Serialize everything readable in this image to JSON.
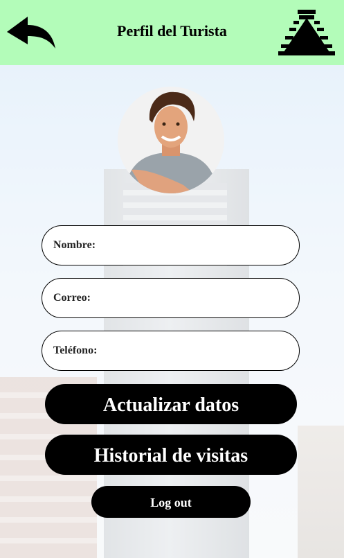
{
  "header": {
    "title": "Perfil del Turista",
    "back_icon": "back-arrow-icon",
    "logo_icon": "pyramid-logo-icon",
    "background_color": "#b3fcb9"
  },
  "profile": {
    "avatar_icon": "user-photo"
  },
  "form": {
    "name_label": "Nombre:",
    "email_label": "Correo:",
    "phone_label": "Teléfono:",
    "name_value": "",
    "email_value": "",
    "phone_value": ""
  },
  "actions": {
    "update_label": "Actualizar datos",
    "history_label": "Historial de visitas",
    "logout_label": "Log out"
  }
}
